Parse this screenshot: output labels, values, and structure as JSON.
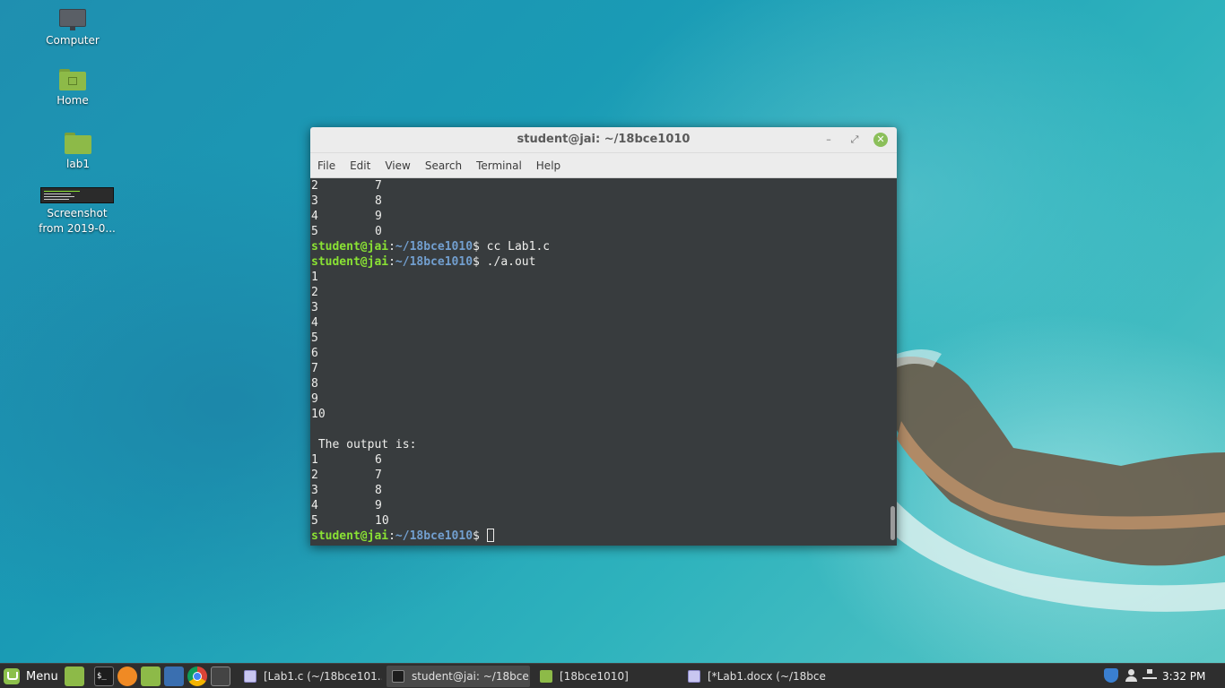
{
  "desktop": {
    "icons": [
      {
        "label": "Computer",
        "icon": "monitor-icon"
      },
      {
        "label": "Home",
        "icon": "home-folder-icon"
      },
      {
        "label": "lab1",
        "icon": "folder-icon"
      },
      {
        "label_line1": "Screenshot",
        "label_line2": "from 2019-0...",
        "icon": "screenshot-thumbnail-icon"
      }
    ]
  },
  "window": {
    "title": "student@jai: ~/18bce1010",
    "controls": {
      "minimize": "–",
      "maximize": "⤢",
      "close": "✕"
    },
    "menu": [
      "File",
      "Edit",
      "View",
      "Search",
      "Terminal",
      "Help"
    ],
    "terminal": {
      "prompt_user": "student@jai",
      "prompt_sep": ":",
      "prompt_path": "~/18bce1010",
      "prompt_end": "$ ",
      "top_rows": [
        {
          "a": "2",
          "b": "7"
        },
        {
          "a": "3",
          "b": "8"
        },
        {
          "a": "4",
          "b": "9"
        },
        {
          "a": "5",
          "b": "0"
        }
      ],
      "command1": "cc Lab1.c",
      "command2": "./a.out",
      "inputs": [
        "1",
        "2",
        "3",
        "4",
        "5",
        "6",
        "7",
        "8",
        "9",
        "10"
      ],
      "output_heading": " The output is:",
      "output_rows": [
        {
          "a": "1",
          "b": "6"
        },
        {
          "a": "2",
          "b": "7"
        },
        {
          "a": "3",
          "b": "8"
        },
        {
          "a": "4",
          "b": "9"
        },
        {
          "a": "5",
          "b": "10"
        }
      ]
    }
  },
  "taskbar": {
    "menu_label": "Menu",
    "launchers": [
      "show-desktop-icon",
      "terminal-icon",
      "firefox-icon",
      "files-icon",
      "camera-icon",
      "chrome-icon",
      "calculator-icon"
    ],
    "launcher_term_glyph": "$_",
    "tasks": [
      {
        "label": "[Lab1.c (~/18bce101...",
        "icon": "document-icon",
        "active": false
      },
      {
        "label": "student@jai: ~/18bce...",
        "icon": "terminal-icon",
        "active": true
      },
      {
        "label": "[18bce1010]",
        "icon": "folder-icon",
        "active": false
      },
      {
        "label": "[*Lab1.docx (~/18bce...",
        "icon": "document-icon",
        "active": false
      }
    ],
    "tray": {
      "clock": "3:32 PM"
    }
  }
}
